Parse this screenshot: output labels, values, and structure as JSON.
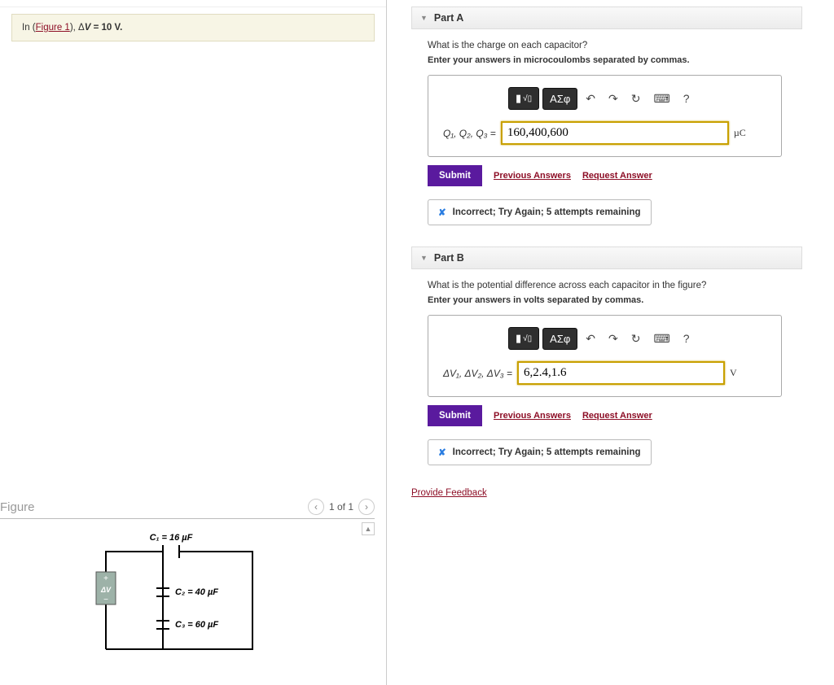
{
  "problem": {
    "in_text": "In (",
    "figure_link": "Figure 1",
    "after_link": "), Δ",
    "var": "V",
    "equals": " = 10 V."
  },
  "figure": {
    "title": "Figure",
    "pager_text": "1 of 1",
    "c1": "C₁ = 16 µF",
    "c2": "C₂ = 40 µF",
    "c3": "C₃ = 60 µF",
    "dv": "ΔV"
  },
  "partA": {
    "header": "Part A",
    "question": "What is the charge on each capacitor?",
    "instruction": "Enter your answers in microcoulombs separated by commas.",
    "label_prefix": "Q",
    "label": "Q₁, Q₂, Q₃ = ",
    "value": "160,400,600",
    "unit": "µC",
    "submit": "Submit",
    "prev": "Previous Answers",
    "req": "Request Answer",
    "feedback": "Incorrect; Try Again; 5 attempts remaining",
    "tool_asig": "ΑΣφ"
  },
  "partB": {
    "header": "Part B",
    "question": "What is the potential difference across each capacitor in the figure?",
    "instruction": "Enter your answers in volts separated by commas.",
    "label": "ΔV₁, ΔV₂, ΔV₃ = ",
    "value": "6,2.4,1.6",
    "unit": "V",
    "submit": "Submit",
    "prev": "Previous Answers",
    "req": "Request Answer",
    "feedback": "Incorrect; Try Again; 5 attempts remaining",
    "tool_asig": "ΑΣφ"
  },
  "links": {
    "provide_feedback": "Provide Feedback"
  },
  "toolbar": {
    "undo_glyph": "↶",
    "redo_glyph": "↷",
    "reset_glyph": "↻",
    "keyboard_glyph": "⌨",
    "help_glyph": "?"
  }
}
